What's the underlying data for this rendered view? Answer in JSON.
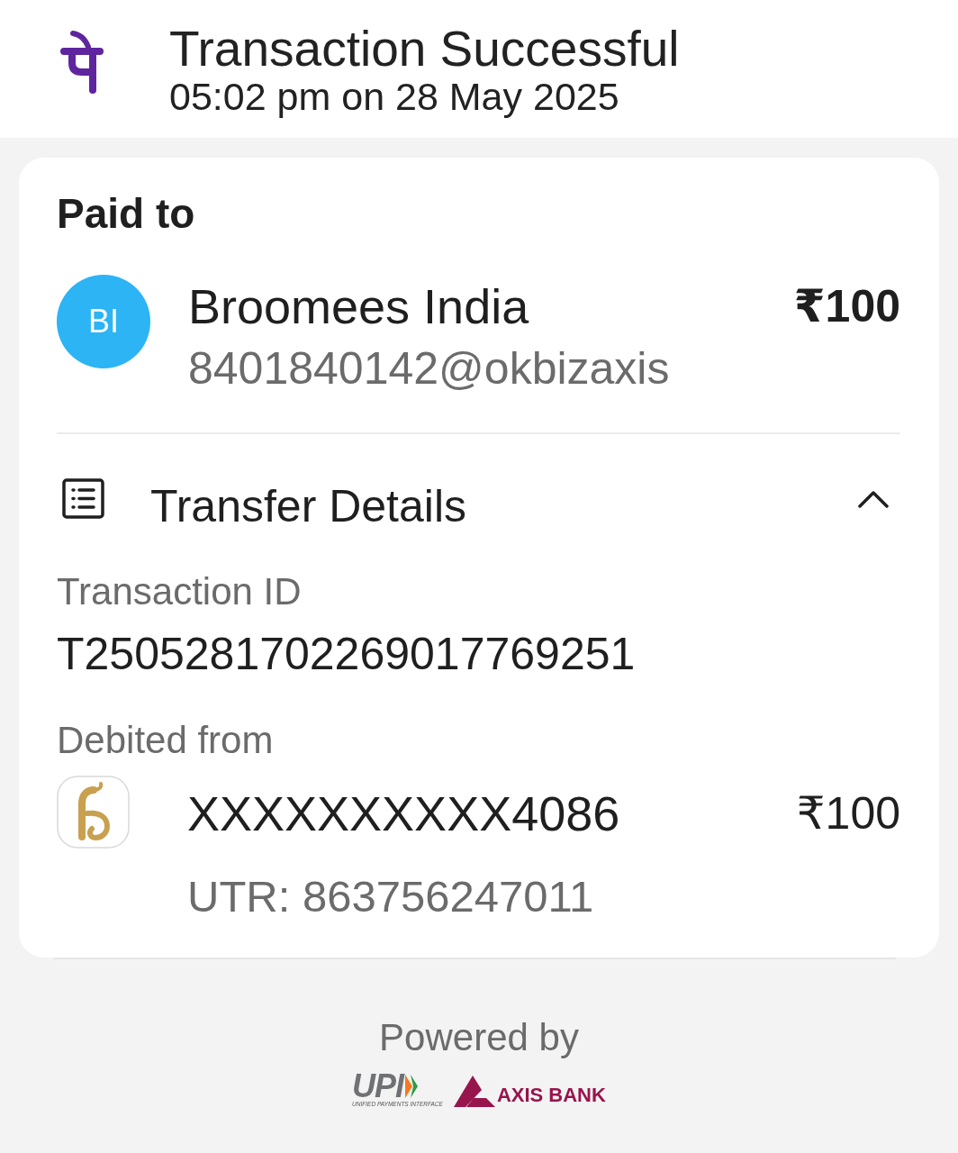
{
  "header": {
    "title": "Transaction Successful",
    "timestamp": "05:02 pm on 28 May 2025"
  },
  "paid_to": {
    "heading": "Paid to",
    "payee": {
      "initials": "BI",
      "name": "Broomees India",
      "upi_id": "8401840142@okbizaxis",
      "amount": "₹100"
    }
  },
  "transfer_details": {
    "title": "Transfer Details",
    "expanded": true,
    "fields": [
      {
        "label": "Transaction ID",
        "value": "T2505281702269017769251"
      }
    ],
    "debited_from": {
      "label": "Debited from",
      "account": "XXXXXXXXXX4086",
      "amount": "₹100",
      "utr": "UTR: 863756247011"
    }
  },
  "footer": {
    "powered_by": "Powered by",
    "partners": [
      {
        "kind": "upi",
        "wordmark": "UPI",
        "tagline": "UNIFIED PAYMENTS INTERFACE"
      },
      {
        "kind": "bank",
        "wordmark": "AXIS BANK"
      }
    ]
  }
}
